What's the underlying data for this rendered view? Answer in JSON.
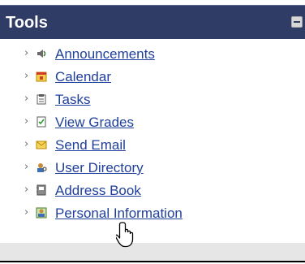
{
  "panel": {
    "title": "Tools"
  },
  "items": [
    {
      "label": "Announcements",
      "icon": "speaker-icon"
    },
    {
      "label": "Calendar",
      "icon": "calendar-icon"
    },
    {
      "label": "Tasks",
      "icon": "clipboard-icon"
    },
    {
      "label": "View Grades",
      "icon": "grades-icon"
    },
    {
      "label": "Send Email",
      "icon": "envelope-icon"
    },
    {
      "label": "User Directory",
      "icon": "user-directory-icon"
    },
    {
      "label": "Address Book",
      "icon": "address-book-icon"
    },
    {
      "label": "Personal Information",
      "icon": "personal-info-icon"
    }
  ],
  "colors": {
    "header_bg": "#2f3d66",
    "link": "#1f3f9a",
    "footer_bg": "#e6e6e6"
  },
  "cursor": "hand-pointer-icon"
}
